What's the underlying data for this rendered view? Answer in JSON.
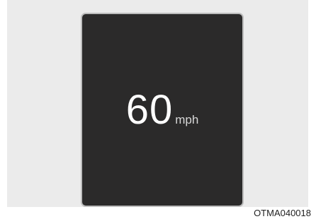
{
  "display": {
    "speed_value": "60",
    "speed_unit": "mph"
  },
  "footer": {
    "image_code": "OTMA040018"
  },
  "colors": {
    "background_panel": "#ebebeb",
    "display_background": "#2b2a2a",
    "display_border": "#bdbdbd",
    "speed_text": "#ffffff",
    "unit_text": "#d8d8d8"
  }
}
